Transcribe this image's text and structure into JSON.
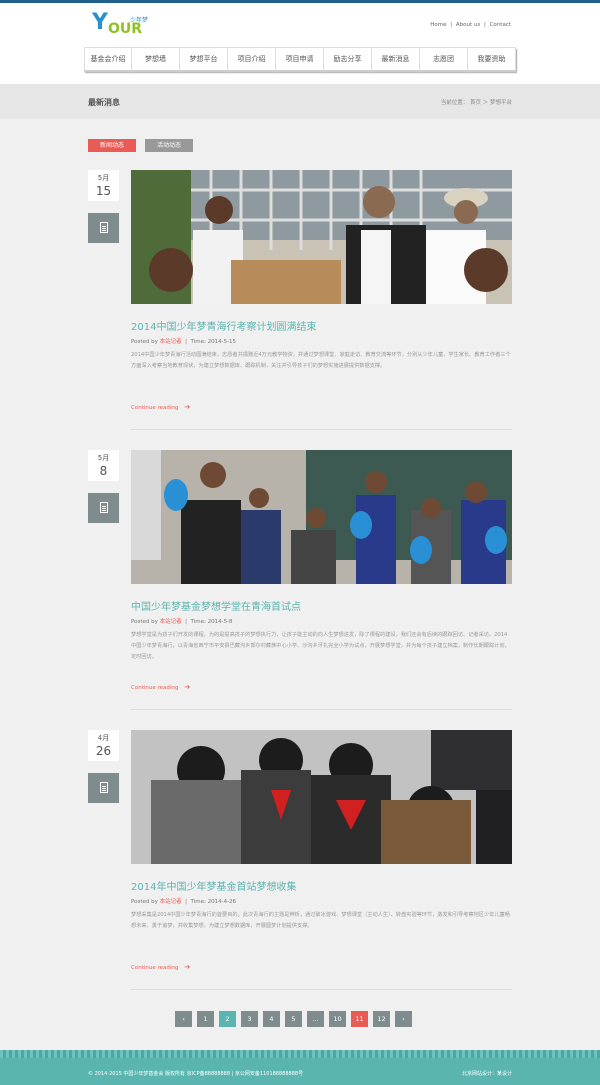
{
  "header": {
    "logo_cn": "少年梦",
    "logo_y": "Y",
    "logo_our": "OUR",
    "toplinks": [
      "Home",
      "About us",
      "Contact"
    ],
    "toplink_sep": "|"
  },
  "nav": [
    "基金会介绍",
    "梦想墙",
    "梦想平台",
    "项目介绍",
    "项目申请",
    "励志分享",
    "最新消息",
    "志愿团",
    "我要资助"
  ],
  "titlebar": {
    "title": "最新消息",
    "breadcrumb": "当前位置： 首页 ＞ 梦想平台"
  },
  "tabs": {
    "news": "新闻动态",
    "activity": "活动动态"
  },
  "posts": [
    {
      "month": "5月",
      "day": "15",
      "title": "2014中国少年梦青海行考察计划圆满结束",
      "posted_by": "Posted by",
      "author": "本站记者",
      "time_label": "Time:",
      "time": "2014-5-15",
      "excerpt": "2014中国少年梦青海行活动圆满结束，志愿者共捐赠近4万元教学物资，并通过梦想课堂、家庭走访、教育交流等环节，分别从少年儿童、学生家长、教育工作者三个方面深入考察当地教育现状，为建立梦想数据库、跟踪机制，关注并引导孩子们的梦想实施进展提供数据支撑。",
      "more": "Continue reading"
    },
    {
      "month": "5月",
      "day": "8",
      "title": "中国少年梦基金梦想学堂在青海首试点",
      "posted_by": "Posted by",
      "author": "本站记者",
      "time_label": "Time:",
      "time": "2014-5-8",
      "excerpt": "梦想学堂是为孩子们开发的课程，为的是提高孩子的梦想执行力，让孩子能主动的向人生梦想进发，除了课程的建设，我们还会有后续的跟踪回访、记者采访。2014中国少年梦青海行，以青海省西宁市平安县巴藏沟乡郭尔村藏族中心小学、沙沟乡牙扎完全小学为试点，开展梦想学堂，并为每个孩子建立档案，制作长期跟踪计划，定时回访。",
      "more": "Continue reading"
    },
    {
      "month": "4月",
      "day": "26",
      "title": "2014年中国少年梦基金首站梦想收集",
      "posted_by": "Posted by",
      "author": "本站记者",
      "time_label": "Time:",
      "time": "2014-4-26",
      "excerpt": "梦想采集是2014中国少年梦青海行的首要目的。此次青海行的主题是辨析，通过破冰游戏、梦想课堂（主动人生）、转盘实验等环节，激发和引导考察地区少年儿童畅想未来、勇于追梦，并收集梦想，为建立梦想数据库，开展圆梦计划提供支撑。",
      "more": "Continue reading"
    }
  ],
  "pagination": [
    "‹",
    "1",
    "2",
    "3",
    "4",
    "5",
    "...",
    "10",
    "11",
    "12",
    "›"
  ],
  "footer": {
    "copyright": "© 2014-2015  中国少年梦基金会  版权所有  京ICP备88888888       |       京公网安备110188888888号",
    "credit": "北京网站设计：某设计"
  },
  "colors": {
    "accent": "#5ab5b0",
    "red": "#e85c55",
    "dark_bar": "#1f5f8b",
    "icon_box": "#7f8c8d"
  }
}
